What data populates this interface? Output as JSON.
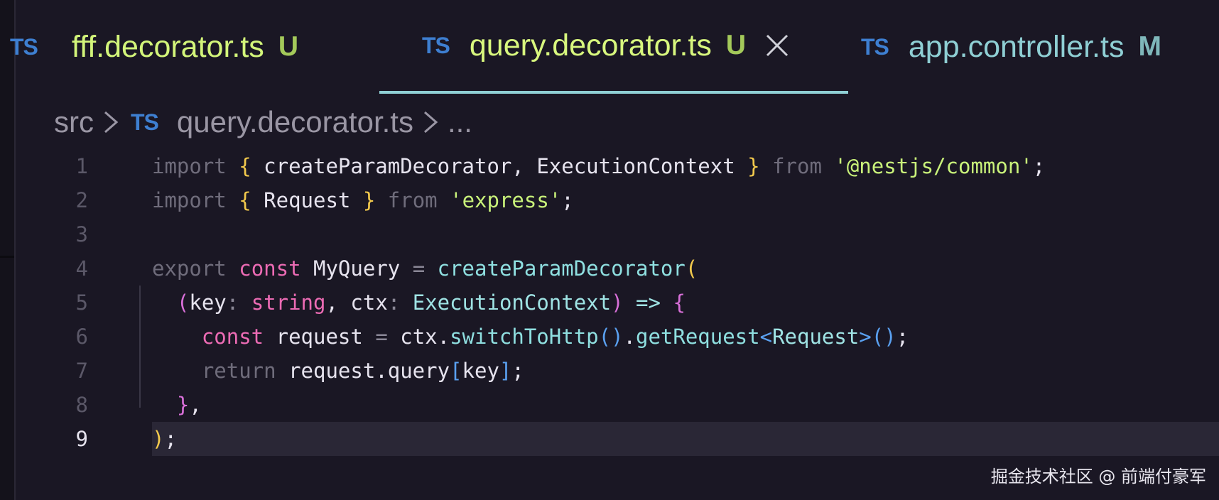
{
  "tabs": [
    {
      "icon": "TS",
      "label": "fff.decorator.ts",
      "status": "U",
      "active": false
    },
    {
      "icon": "TS",
      "label": "query.decorator.ts",
      "status": "U",
      "active": true
    },
    {
      "icon": "TS",
      "label": "app.controller.ts",
      "status": "M",
      "active": false
    }
  ],
  "breadcrumb": {
    "folder": "src",
    "file_icon": "TS",
    "file": "query.decorator.ts",
    "more": "..."
  },
  "editor": {
    "current_line": 9,
    "lines": [
      {
        "n": "1",
        "tokens": [
          [
            "kw",
            "import"
          ],
          [
            "sp",
            " "
          ],
          [
            "brace",
            "{"
          ],
          [
            "sp",
            " "
          ],
          [
            "id",
            "createParamDecorator"
          ],
          [
            "id",
            ","
          ],
          [
            "sp",
            " "
          ],
          [
            "id",
            "ExecutionContext"
          ],
          [
            "sp",
            " "
          ],
          [
            "brace",
            "}"
          ],
          [
            "sp",
            " "
          ],
          [
            "kw",
            "from"
          ],
          [
            "sp",
            " "
          ],
          [
            "str",
            "'@nestjs/common'"
          ],
          [
            "id",
            ";"
          ]
        ]
      },
      {
        "n": "2",
        "tokens": [
          [
            "kw",
            "import"
          ],
          [
            "sp",
            " "
          ],
          [
            "brace",
            "{"
          ],
          [
            "sp",
            " "
          ],
          [
            "id",
            "Request"
          ],
          [
            "sp",
            " "
          ],
          [
            "brace",
            "}"
          ],
          [
            "sp",
            " "
          ],
          [
            "kw",
            "from"
          ],
          [
            "sp",
            " "
          ],
          [
            "str",
            "'express'"
          ],
          [
            "id",
            ";"
          ]
        ]
      },
      {
        "n": "3",
        "tokens": []
      },
      {
        "n": "4",
        "tokens": [
          [
            "kw",
            "export"
          ],
          [
            "sp",
            " "
          ],
          [
            "kw2",
            "const"
          ],
          [
            "sp",
            " "
          ],
          [
            "id",
            "MyQuery"
          ],
          [
            "sp",
            " "
          ],
          [
            "op",
            "="
          ],
          [
            "sp",
            " "
          ],
          [
            "fn",
            "createParamDecorator"
          ],
          [
            "brace",
            "("
          ]
        ]
      },
      {
        "n": "5",
        "tokens": [
          [
            "sp",
            "  "
          ],
          [
            "paren2",
            "("
          ],
          [
            "id",
            "key"
          ],
          [
            "op",
            ":"
          ],
          [
            "sp",
            " "
          ],
          [
            "type",
            "string"
          ],
          [
            "id",
            ","
          ],
          [
            "sp",
            " "
          ],
          [
            "id",
            "ctx"
          ],
          [
            "op",
            ":"
          ],
          [
            "sp",
            " "
          ],
          [
            "cls",
            "ExecutionContext"
          ],
          [
            "paren2",
            ")"
          ],
          [
            "sp",
            " "
          ],
          [
            "cls",
            "=>"
          ],
          [
            "sp",
            " "
          ],
          [
            "paren2",
            "{"
          ]
        ]
      },
      {
        "n": "6",
        "tokens": [
          [
            "sp",
            "    "
          ],
          [
            "kw2",
            "const"
          ],
          [
            "sp",
            " "
          ],
          [
            "id",
            "request"
          ],
          [
            "sp",
            " "
          ],
          [
            "op",
            "="
          ],
          [
            "sp",
            " "
          ],
          [
            "id",
            "ctx."
          ],
          [
            "fn",
            "switchToHttp"
          ],
          [
            "blue",
            "()"
          ],
          [
            "id",
            "."
          ],
          [
            "fn",
            "getRequest"
          ],
          [
            "blue",
            "<"
          ],
          [
            "cls",
            "Request"
          ],
          [
            "blue",
            ">()"
          ],
          [
            "id",
            ";"
          ]
        ]
      },
      {
        "n": "7",
        "tokens": [
          [
            "sp",
            "    "
          ],
          [
            "kw",
            "return"
          ],
          [
            "sp",
            " "
          ],
          [
            "id",
            "request.query"
          ],
          [
            "blue",
            "["
          ],
          [
            "id",
            "key"
          ],
          [
            "blue",
            "]"
          ],
          [
            "id",
            ";"
          ]
        ]
      },
      {
        "n": "8",
        "tokens": [
          [
            "sp",
            "  "
          ],
          [
            "paren2",
            "}"
          ],
          [
            "id",
            ","
          ]
        ]
      },
      {
        "n": "9",
        "tokens": [
          [
            "brace",
            ")"
          ],
          [
            "id",
            ";"
          ]
        ]
      }
    ]
  },
  "watermark": "掘金技术社区 @ 前端付豪军",
  "icons": {
    "close": "close-icon",
    "breadcrumb_separator": "chevron-right-icon"
  },
  "colors": {
    "background": "#1a1724",
    "ts_icon": "#3e7fd1",
    "active_tab_underline": "#8fcfd4",
    "untracked": "#a4c95a",
    "modified": "#7fb7ba"
  }
}
